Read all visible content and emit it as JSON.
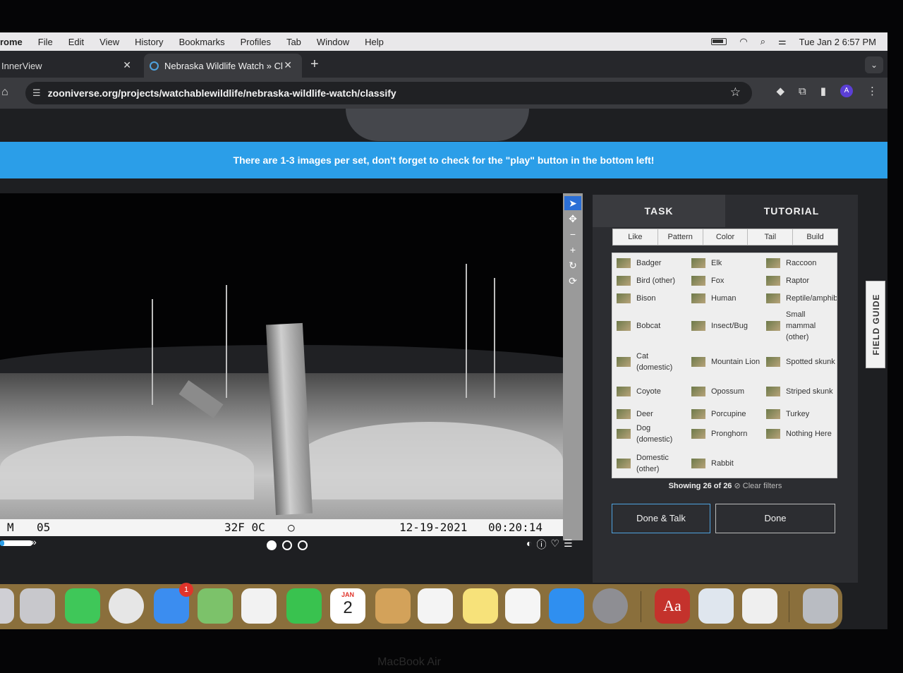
{
  "menubar": {
    "app": "rome",
    "items": [
      "File",
      "Edit",
      "View",
      "History",
      "Bookmarks",
      "Profiles",
      "Tab",
      "Window",
      "Help"
    ],
    "clock": "Tue Jan 2  6:57 PM"
  },
  "tabs": [
    {
      "title": "InnerView"
    },
    {
      "title": "Nebraska Wildlife Watch » Cl"
    }
  ],
  "address": {
    "url": "zooniverse.org/projects/watchablewildlife/nebraska-wildlife-watch/classify"
  },
  "banner": {
    "text": "There are 1-3 images per set, don't forget to check for the \"play\" button in the bottom left!"
  },
  "camera": {
    "mode": "M",
    "number": "05",
    "temp": "32F  0C",
    "date": "12-19-2021",
    "time": "00:20:14"
  },
  "task_panel": {
    "tabs": [
      "TASK",
      "TUTORIAL"
    ],
    "filters": [
      "Like",
      "Pattern",
      "Color",
      "Tail",
      "Build"
    ],
    "species": [
      [
        "Badger",
        "Elk",
        "Raccoon"
      ],
      [
        "Bird (other)",
        "Fox",
        "Raptor"
      ],
      [
        "Bison",
        "Human",
        "Reptile/amphibian"
      ],
      [
        "Bobcat",
        "Insect/Bug",
        "Small mammal (other)"
      ],
      [
        "Cat (domestic)",
        "Mountain Lion",
        "Spotted skunk"
      ],
      [
        "Coyote",
        "Opossum",
        "Striped skunk"
      ],
      [
        "Deer",
        "Porcupine",
        "Turkey"
      ],
      [
        "Dog (domestic)",
        "Pronghorn",
        "Nothing Here"
      ],
      [
        "Domestic (other)",
        "Rabbit",
        ""
      ]
    ],
    "showing": "Showing 26 of 26",
    "clear": "Clear filters",
    "done_talk": "Done & Talk",
    "done": "Done"
  },
  "field_guide": "FIELD GUIDE",
  "dock": {
    "calendar_month": "JAN",
    "calendar_day": "2",
    "mail_badge": "1",
    "dictionary": "Aa"
  },
  "laptop": "MacBook Air"
}
